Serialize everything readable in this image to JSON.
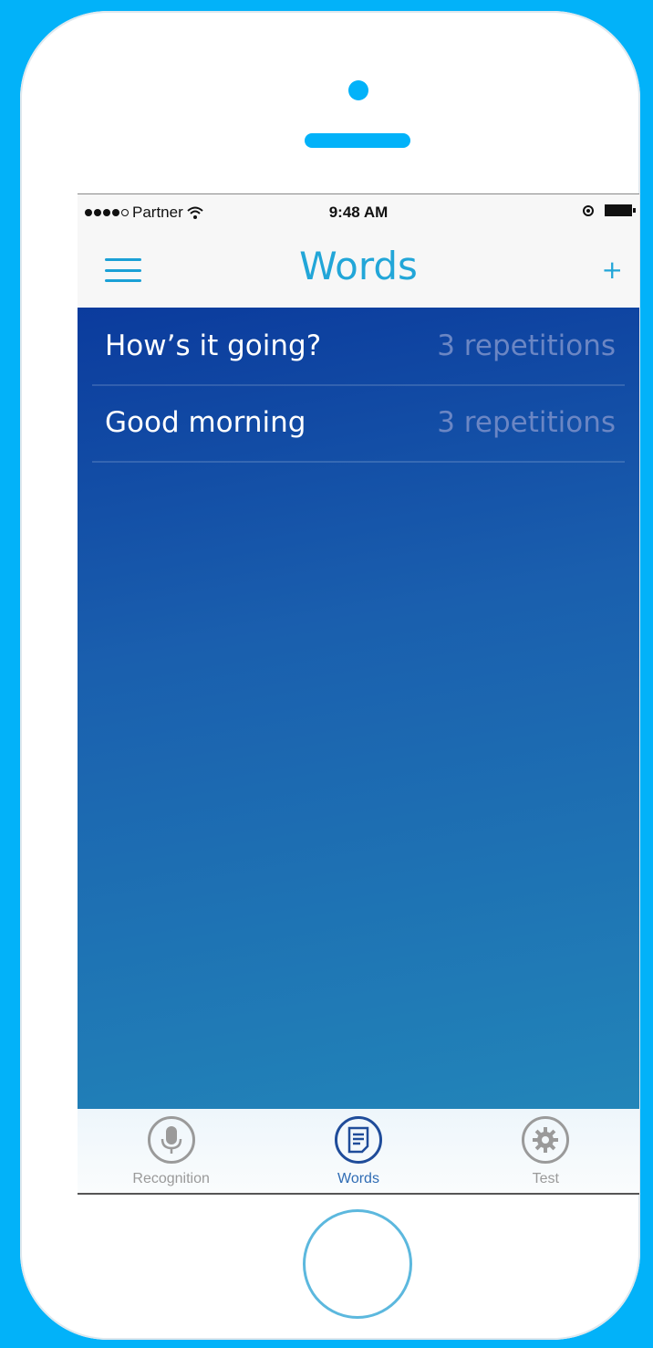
{
  "status_bar": {
    "carrier": "Partner",
    "time": "9:48 AM"
  },
  "nav": {
    "title": "Words",
    "add_label": "+"
  },
  "words": [
    {
      "phrase": "How’s it going?",
      "count": "3 repetitions"
    },
    {
      "phrase": "Good morning",
      "count": "3 repetitions"
    }
  ],
  "tabs": [
    {
      "label": "Recognition",
      "icon": "microphone-icon",
      "active": false
    },
    {
      "label": "Words",
      "icon": "document-icon",
      "active": true
    },
    {
      "label": "Test",
      "icon": "gear-icon",
      "active": false
    }
  ],
  "colors": {
    "background": "#02B2F9",
    "accent": "#22a6d8",
    "content_top": "#0b3b9d",
    "content_bottom": "#2285b9"
  }
}
